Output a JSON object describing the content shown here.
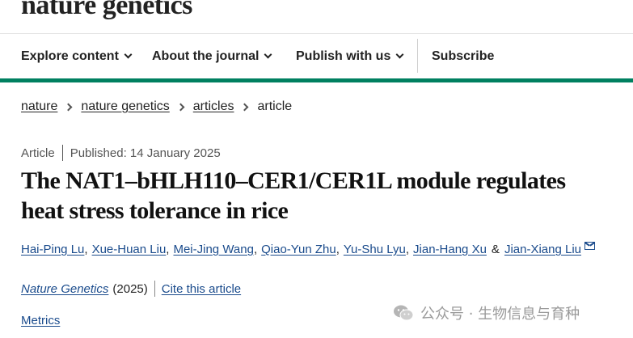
{
  "header": {
    "logo": "nature genetics"
  },
  "nav": {
    "items": [
      {
        "label": "Explore content"
      },
      {
        "label": "About the journal"
      },
      {
        "label": "Publish with us"
      }
    ],
    "subscribe": "Subscribe"
  },
  "breadcrumb": {
    "items": [
      "nature",
      "nature genetics",
      "articles"
    ],
    "current": "article"
  },
  "article": {
    "type": "Article",
    "published": "Published: 14 January 2025",
    "title_line1": "The NAT1–bHLH110–CER1/CER1L module regulates",
    "title_line2": "heat stress tolerance in rice",
    "authors": [
      "Hai-Ping Lu",
      "Xue-Huan Liu",
      "Mei-Jing Wang",
      "Qiao-Yun Zhu",
      "Yu-Shu Lyu",
      "Jian-Hang Xu",
      "Jian-Xiang Liu"
    ],
    "separator": ",",
    "ampersand": "&",
    "journal": "Nature Genetics",
    "year": "(2025)",
    "cite_label": "Cite this article",
    "metrics_label": "Metrics"
  },
  "watermark": {
    "text": "公众号 · 生物信息与育种"
  },
  "colors": {
    "accent_green": "#008060",
    "link_blue": "#1a4b8c"
  }
}
